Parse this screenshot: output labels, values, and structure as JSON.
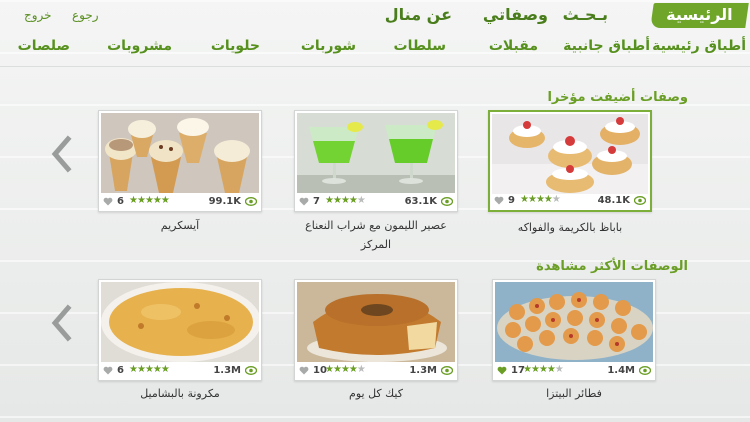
{
  "topnav": {
    "home": "الرئيسية",
    "search": "بـحـث",
    "my_recipes": "وصفاتي",
    "about": "عن منال",
    "back": "رجوع",
    "logout": "خروج"
  },
  "categories": [
    "أطباق رئيسية",
    "أطباق جانبية",
    "مقبلات",
    "سلطات",
    "شوربات",
    "حلويات",
    "مشروبات",
    "صلصات"
  ],
  "sections": {
    "recent": {
      "title": "وصفات أضيفت مؤخرا",
      "cards": [
        {
          "name": "باباظ بالكريمة والفواكه",
          "views": "48.1K",
          "stars": 4,
          "rating": "9",
          "selected": true
        },
        {
          "name": "عصير الليمون مع شراب النعناع المركز",
          "views": "63.1K",
          "stars": 4,
          "rating": "7",
          "selected": false
        },
        {
          "name": "آيسكريم",
          "views": "99.1K",
          "stars": 5,
          "rating": "6",
          "selected": false
        }
      ]
    },
    "popular": {
      "title": "الوصفات الأكثر مشاهدة",
      "cards": [
        {
          "name": "فطائر البيتزا",
          "views": "1.4M",
          "stars": 4,
          "rating": "17",
          "selected": false
        },
        {
          "name": "كيك كل يوم",
          "views": "1.3M",
          "stars": 4,
          "rating": "10",
          "selected": false
        },
        {
          "name": "مكرونة بالبشاميل",
          "views": "1.3M",
          "stars": 5,
          "rating": "6",
          "selected": false
        }
      ]
    }
  },
  "colors": {
    "accent": "#6fa62a",
    "text_green": "#56901d",
    "star_on": "#6a9e25",
    "star_off": "#b9bcbb"
  },
  "icons": {
    "views": "eye-icon",
    "favorite": "heart-icon",
    "prev": "chevron-left-icon"
  }
}
